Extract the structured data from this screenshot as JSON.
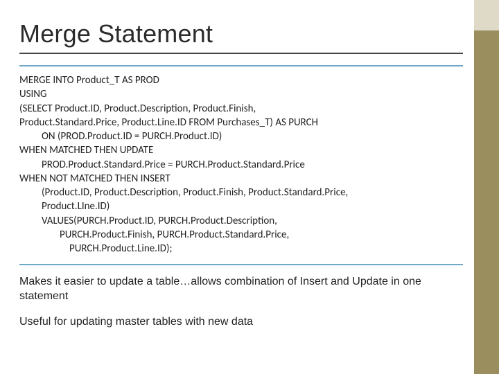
{
  "title": "Merge Statement",
  "sql": {
    "l1": "MERGE INTO Product_T AS PROD",
    "l2": "USING",
    "l3": "(SELECT Product.ID, Product.Description, Product.Finish,",
    "l4": "Product.Standard.Price, Product.Line.ID FROM Purchases_T) AS PURCH",
    "l5": "ON (PROD.Product.ID = PURCH.Product.ID)",
    "l6": "WHEN MATCHED THEN UPDATE",
    "l7": "PROD.Product.Standard.Price = PURCH.Product.Standard.Price",
    "l8": "WHEN NOT MATCHED THEN INSERT",
    "l9": "(Product.ID, Product.Description, Product.Finish, Product.Standard.Price,",
    "l10": "Product.LIne.ID)",
    "l11": "VALUES(PURCH.Product.ID, PURCH.Product.Description,",
    "l12": "PURCH.Product.Finish, PURCH.Product.Standard.Price,",
    "l13": "PURCH.Product.Line.ID);"
  },
  "notes": {
    "p1": "Makes it easier to update a table…allows combination of Insert and Update in one statement",
    "p2": "Useful for updating master tables with new data"
  }
}
